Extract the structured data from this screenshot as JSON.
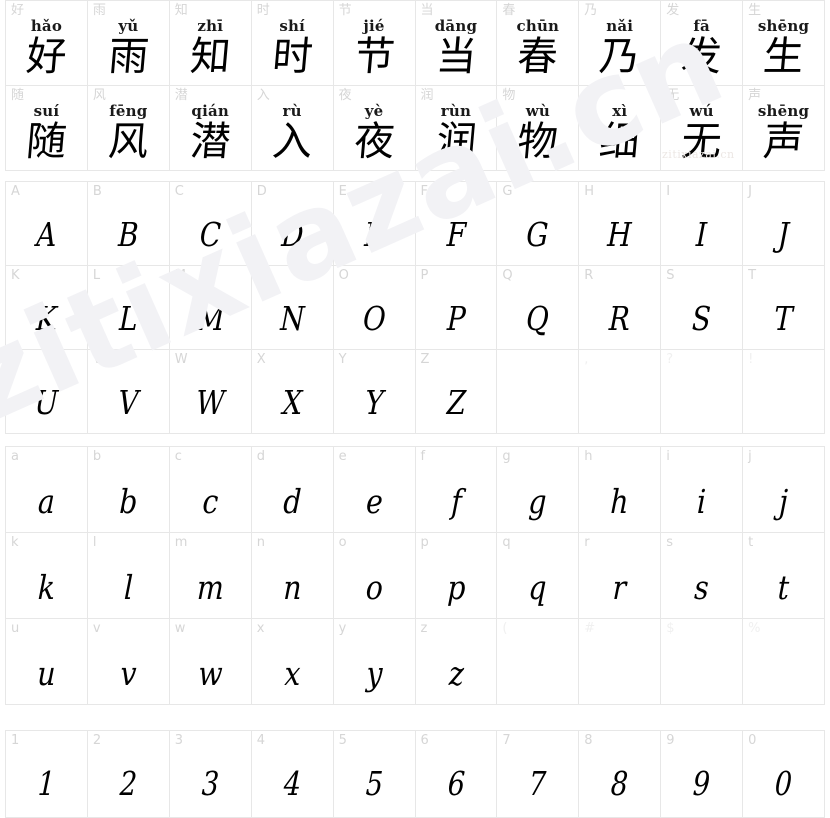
{
  "page": {
    "background": "#ffffff",
    "grid_line_color": "#e7e7e7",
    "corner_label_color": "#d6d6d6",
    "glyph_color": "#000000",
    "watermark_color": "#f2f2f5"
  },
  "watermark": {
    "large_text": "zitixiazai.cn",
    "small_text": "zitixiazai.cn"
  },
  "sections": {
    "hanzi": {
      "name": "chinese-character-preview",
      "cells": [
        {
          "label": "好",
          "pinyin": "hǎo",
          "glyph": "好"
        },
        {
          "label": "雨",
          "pinyin": "yǔ",
          "glyph": "雨"
        },
        {
          "label": "知",
          "pinyin": "zhī",
          "glyph": "知"
        },
        {
          "label": "时",
          "pinyin": "shí",
          "glyph": "时"
        },
        {
          "label": "节",
          "pinyin": "jié",
          "glyph": "节"
        },
        {
          "label": "当",
          "pinyin": "dāng",
          "glyph": "当"
        },
        {
          "label": "春",
          "pinyin": "chūn",
          "glyph": "春"
        },
        {
          "label": "乃",
          "pinyin": "nǎi",
          "glyph": "乃"
        },
        {
          "label": "发",
          "pinyin": "fā",
          "glyph": "发"
        },
        {
          "label": "生",
          "pinyin": "shēng",
          "glyph": "生"
        },
        {
          "label": "随",
          "pinyin": "suí",
          "glyph": "随"
        },
        {
          "label": "风",
          "pinyin": "fēng",
          "glyph": "风"
        },
        {
          "label": "潜",
          "pinyin": "qián",
          "glyph": "潜"
        },
        {
          "label": "入",
          "pinyin": "rù",
          "glyph": "入"
        },
        {
          "label": "夜",
          "pinyin": "yè",
          "glyph": "夜"
        },
        {
          "label": "润",
          "pinyin": "rùn",
          "glyph": "润"
        },
        {
          "label": "物",
          "pinyin": "wù",
          "glyph": "物"
        },
        {
          "label": "细",
          "pinyin": "xì",
          "glyph": "细"
        },
        {
          "label": "无",
          "pinyin": "wú",
          "glyph": "无"
        },
        {
          "label": "声",
          "pinyin": "shēng",
          "glyph": "声"
        }
      ]
    },
    "uppercase": {
      "name": "uppercase-latin-preview",
      "cells": [
        {
          "label": "A",
          "glyph": "A"
        },
        {
          "label": "B",
          "glyph": "B"
        },
        {
          "label": "C",
          "glyph": "C"
        },
        {
          "label": "D",
          "glyph": "D"
        },
        {
          "label": "E",
          "glyph": "E"
        },
        {
          "label": "F",
          "glyph": "F"
        },
        {
          "label": "G",
          "glyph": "G"
        },
        {
          "label": "H",
          "glyph": "H"
        },
        {
          "label": "I",
          "glyph": "I"
        },
        {
          "label": "J",
          "glyph": "J"
        },
        {
          "label": "K",
          "glyph": "K"
        },
        {
          "label": "L",
          "glyph": "L"
        },
        {
          "label": "M",
          "glyph": "M"
        },
        {
          "label": "N",
          "glyph": "N"
        },
        {
          "label": "O",
          "glyph": "O"
        },
        {
          "label": "P",
          "glyph": "P"
        },
        {
          "label": "Q",
          "glyph": "Q"
        },
        {
          "label": "R",
          "glyph": "R"
        },
        {
          "label": "S",
          "glyph": "S"
        },
        {
          "label": "T",
          "glyph": "T"
        },
        {
          "label": "U",
          "glyph": "U"
        },
        {
          "label": "V",
          "glyph": "V"
        },
        {
          "label": "W",
          "glyph": "W"
        },
        {
          "label": "X",
          "glyph": "X"
        },
        {
          "label": "Y",
          "glyph": "Y"
        },
        {
          "label": "Z",
          "glyph": "Z"
        },
        {
          "label": "",
          "glyph": "",
          "faint": true
        },
        {
          "label": ",",
          "glyph": "",
          "faint": true
        },
        {
          "label": "?",
          "glyph": "",
          "faint": true
        },
        {
          "label": "!",
          "glyph": "",
          "faint": true
        }
      ]
    },
    "lowercase": {
      "name": "lowercase-latin-preview",
      "cells": [
        {
          "label": "a",
          "glyph": "a"
        },
        {
          "label": "b",
          "glyph": "b"
        },
        {
          "label": "c",
          "glyph": "c"
        },
        {
          "label": "d",
          "glyph": "d"
        },
        {
          "label": "e",
          "glyph": "e"
        },
        {
          "label": "f",
          "glyph": "f"
        },
        {
          "label": "g",
          "glyph": "g"
        },
        {
          "label": "h",
          "glyph": "h"
        },
        {
          "label": "i",
          "glyph": "i"
        },
        {
          "label": "j",
          "glyph": "j"
        },
        {
          "label": "k",
          "glyph": "k"
        },
        {
          "label": "l",
          "glyph": "l"
        },
        {
          "label": "m",
          "glyph": "m"
        },
        {
          "label": "n",
          "glyph": "n"
        },
        {
          "label": "o",
          "glyph": "o"
        },
        {
          "label": "p",
          "glyph": "p"
        },
        {
          "label": "q",
          "glyph": "q"
        },
        {
          "label": "r",
          "glyph": "r"
        },
        {
          "label": "s",
          "glyph": "s"
        },
        {
          "label": "t",
          "glyph": "t"
        },
        {
          "label": "u",
          "glyph": "u"
        },
        {
          "label": "v",
          "glyph": "v"
        },
        {
          "label": "w",
          "glyph": "w"
        },
        {
          "label": "x",
          "glyph": "x"
        },
        {
          "label": "y",
          "glyph": "y"
        },
        {
          "label": "z",
          "glyph": "z"
        },
        {
          "label": "(",
          "glyph": "",
          "faint": true
        },
        {
          "label": "#",
          "glyph": "",
          "faint": true
        },
        {
          "label": "$",
          "glyph": "",
          "faint": true
        },
        {
          "label": "%",
          "glyph": "",
          "faint": true
        }
      ]
    },
    "digits": {
      "name": "digit-preview",
      "cells": [
        {
          "label": "1",
          "glyph": "1"
        },
        {
          "label": "2",
          "glyph": "2"
        },
        {
          "label": "3",
          "glyph": "3"
        },
        {
          "label": "4",
          "glyph": "4"
        },
        {
          "label": "5",
          "glyph": "5"
        },
        {
          "label": "6",
          "glyph": "6"
        },
        {
          "label": "7",
          "glyph": "7"
        },
        {
          "label": "8",
          "glyph": "8"
        },
        {
          "label": "9",
          "glyph": "9"
        },
        {
          "label": "0",
          "glyph": "0"
        }
      ]
    }
  }
}
